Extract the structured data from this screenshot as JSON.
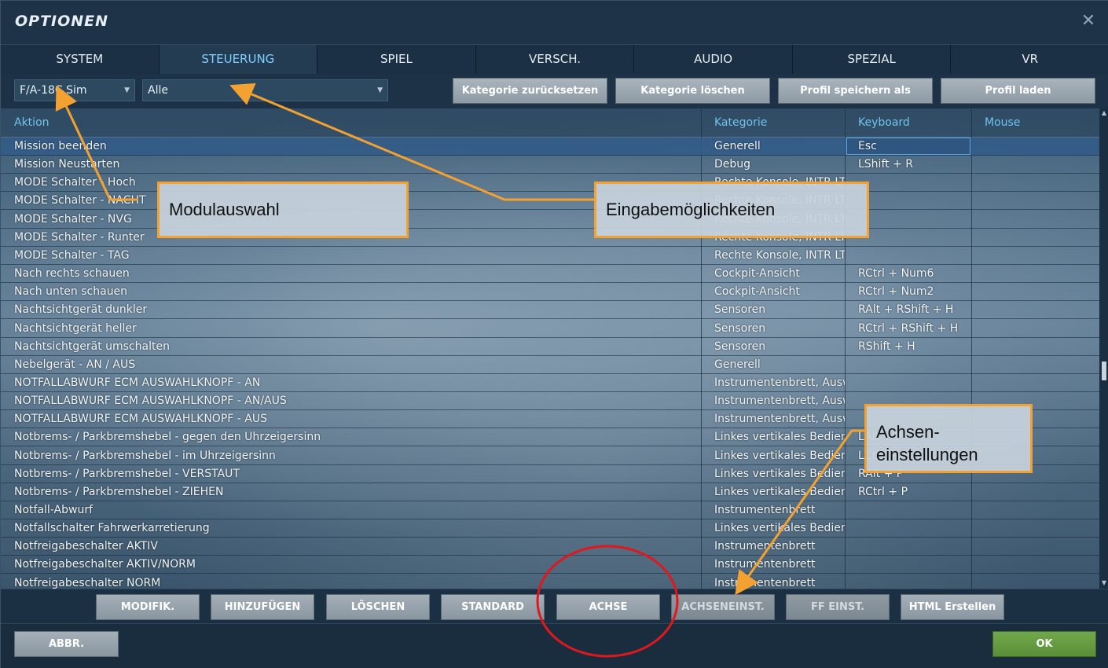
{
  "window": {
    "title": "OPTIONEN",
    "close_glyph": "✕"
  },
  "tabs": [
    {
      "label": "SYSTEM",
      "active": false
    },
    {
      "label": "STEUERUNG",
      "active": true
    },
    {
      "label": "SPIEL",
      "active": false
    },
    {
      "label": "VERSCH.",
      "active": false
    },
    {
      "label": "AUDIO",
      "active": false
    },
    {
      "label": "SPEZIAL",
      "active": false
    },
    {
      "label": "VR",
      "active": false
    }
  ],
  "toolbar": {
    "module_select": "F/A-18C Sim",
    "category_select": "Alle",
    "reset_category": "Kategorie zurücksetzen",
    "clear_category": "Kategorie löschen",
    "save_profile": "Profil speichern als",
    "load_profile": "Profil laden"
  },
  "table": {
    "headers": {
      "action": "Aktion",
      "category": "Kategorie",
      "keyboard": "Keyboard",
      "mouse": "Mouse"
    },
    "rows": [
      {
        "action": "Mission beenden",
        "category": "Generell",
        "keyboard": "Esc",
        "mouse": ""
      },
      {
        "action": "Mission Neustarten",
        "category": "Debug",
        "keyboard": "LShift + R",
        "mouse": ""
      },
      {
        "action": "MODE Schalter - Hoch",
        "category": "Rechte Konsole, INTR LT E",
        "keyboard": "",
        "mouse": ""
      },
      {
        "action": "MODE Schalter - NACHT",
        "category": "Rechte Konsole, INTR LT E",
        "keyboard": "",
        "mouse": ""
      },
      {
        "action": "MODE Schalter - NVG",
        "category": "Rechte Konsole, INTR LT E",
        "keyboard": "",
        "mouse": ""
      },
      {
        "action": "MODE Schalter - Runter",
        "category": "Rechte Konsole, INTR LT E",
        "keyboard": "",
        "mouse": ""
      },
      {
        "action": "MODE Schalter - TAG",
        "category": "Rechte Konsole, INTR LT E",
        "keyboard": "",
        "mouse": ""
      },
      {
        "action": "Nach rechts schauen",
        "category": "Cockpit-Ansicht",
        "keyboard": "RCtrl + Num6",
        "mouse": ""
      },
      {
        "action": "Nach unten schauen",
        "category": "Cockpit-Ansicht",
        "keyboard": "RCtrl + Num2",
        "mouse": ""
      },
      {
        "action": "Nachtsichtgerät dunkler",
        "category": "Sensoren",
        "keyboard": "RAlt + RShift + H",
        "mouse": ""
      },
      {
        "action": "Nachtsichtgerät heller",
        "category": "Sensoren",
        "keyboard": "RCtrl + RShift + H",
        "mouse": ""
      },
      {
        "action": "Nachtsichtgerät umschalten",
        "category": "Sensoren",
        "keyboard": "RShift + H",
        "mouse": ""
      },
      {
        "action": "Nebelgerät - AN / AUS",
        "category": "Generell",
        "keyboard": "",
        "mouse": ""
      },
      {
        "action": "NOTFALLABWURF ECM AUSWAHLKNOPF - AN",
        "category": "Instrumentenbrett, Auswa",
        "keyboard": "",
        "mouse": ""
      },
      {
        "action": "NOTFALLABWURF ECM AUSWAHLKNOPF - AN/AUS",
        "category": "Instrumentenbrett, Auswa",
        "keyboard": "",
        "mouse": ""
      },
      {
        "action": "NOTFALLABWURF ECM AUSWAHLKNOPF - AUS",
        "category": "Instrumentenbrett, Auswa",
        "keyboard": "",
        "mouse": ""
      },
      {
        "action": "Notbrems- / Parkbremshebel - gegen den Uhrzeigersinn",
        "category": "Linkes vertikales Bedienfe",
        "keyboard": "LAlt + P",
        "mouse": ""
      },
      {
        "action": "Notbrems- / Parkbremshebel - im Uhrzeigersinn",
        "category": "Linkes vertikales Bedienfe",
        "keyboard": "LCtrl + P",
        "mouse": ""
      },
      {
        "action": "Notbrems- / Parkbremshebel - VERSTAUT",
        "category": "Linkes vertikales Bedienfe",
        "keyboard": "RAlt + P",
        "mouse": ""
      },
      {
        "action": "Notbrems- / Parkbremshebel - ZIEHEN",
        "category": "Linkes vertikales Bedienfe",
        "keyboard": "RCtrl + P",
        "mouse": ""
      },
      {
        "action": "Notfall-Abwurf",
        "category": "Instrumentenbrett",
        "keyboard": "",
        "mouse": ""
      },
      {
        "action": "Notfallschalter Fahrwerkarretierung",
        "category": "Linkes vertikales Bedienfe",
        "keyboard": "",
        "mouse": ""
      },
      {
        "action": "Notfreigabeschalter AKTIV",
        "category": "Instrumentenbrett",
        "keyboard": "",
        "mouse": ""
      },
      {
        "action": "Notfreigabeschalter AKTIV/NORM",
        "category": "Instrumentenbrett",
        "keyboard": "",
        "mouse": ""
      },
      {
        "action": "Notfreigabeschalter NORM",
        "category": "Instrumentenbrett",
        "keyboard": "",
        "mouse": ""
      }
    ]
  },
  "bottom_buttons": {
    "modifiers": "MODIFIK.",
    "add": "HINZUFÜGEN",
    "delete": "LÖSCHEN",
    "default": "STANDARD",
    "axis": "ACHSE",
    "axis_settings": "ACHSENEINST.",
    "ff_settings": "FF EINST.",
    "html": "HTML Erstellen"
  },
  "footer": {
    "cancel": "ABBR.",
    "ok": "OK"
  },
  "annotations": {
    "module": "Modulauswahl",
    "input": "Eingabemöglichkeiten",
    "axis_line1": "Achsen-",
    "axis_line2": "einstellungen"
  },
  "colors": {
    "accent_tab": "#7fd0ff",
    "header_text": "#6fc3ee",
    "annotation_border": "#f3a131",
    "circle": "#e0181b",
    "ok_button": "#66a042"
  }
}
